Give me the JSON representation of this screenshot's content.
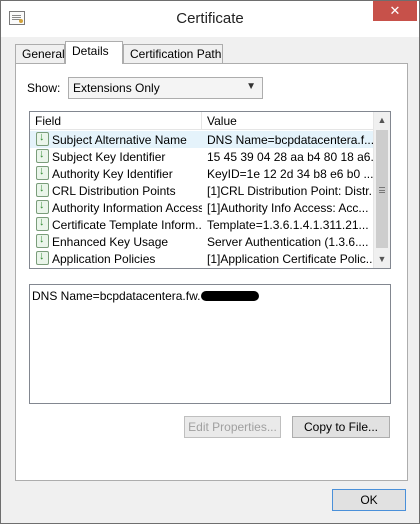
{
  "window": {
    "title": "Certificate",
    "close_glyph": "✕"
  },
  "tabs": [
    {
      "label": "General"
    },
    {
      "label": "Details"
    },
    {
      "label": "Certification Path"
    }
  ],
  "show": {
    "label": "Show:",
    "selected": "Extensions Only"
  },
  "list": {
    "headers": {
      "field": "Field",
      "value": "Value"
    },
    "rows": [
      {
        "field": "Subject Alternative Name",
        "value": "DNS Name=bcpdatacentera.f..."
      },
      {
        "field": "Subject Key Identifier",
        "value": "15 45 39 04 28 aa b4 80 18 a6..."
      },
      {
        "field": "Authority Key Identifier",
        "value": "KeyID=1e 12 2d 34 b8 e6 b0 ..."
      },
      {
        "field": "CRL Distribution Points",
        "value": "[1]CRL Distribution Point: Distr..."
      },
      {
        "field": "Authority Information Access",
        "value": "[1]Authority Info Access: Acc..."
      },
      {
        "field": "Certificate Template Inform...",
        "value": "Template=1.3.6.1.4.1.311.21..."
      },
      {
        "field": "Enhanced Key Usage",
        "value": "Server Authentication (1.3.6...."
      },
      {
        "field": "Application Policies",
        "value": "[1]Application Certificate Polic..."
      }
    ]
  },
  "detail_text": "DNS Name=bcpdatacentera.fw.",
  "buttons": {
    "edit_properties": "Edit Properties...",
    "copy_to_file": "Copy to File...",
    "ok": "OK"
  },
  "colors": {
    "close_button": "#c7514a",
    "selected_row": "#e5f3fb"
  }
}
